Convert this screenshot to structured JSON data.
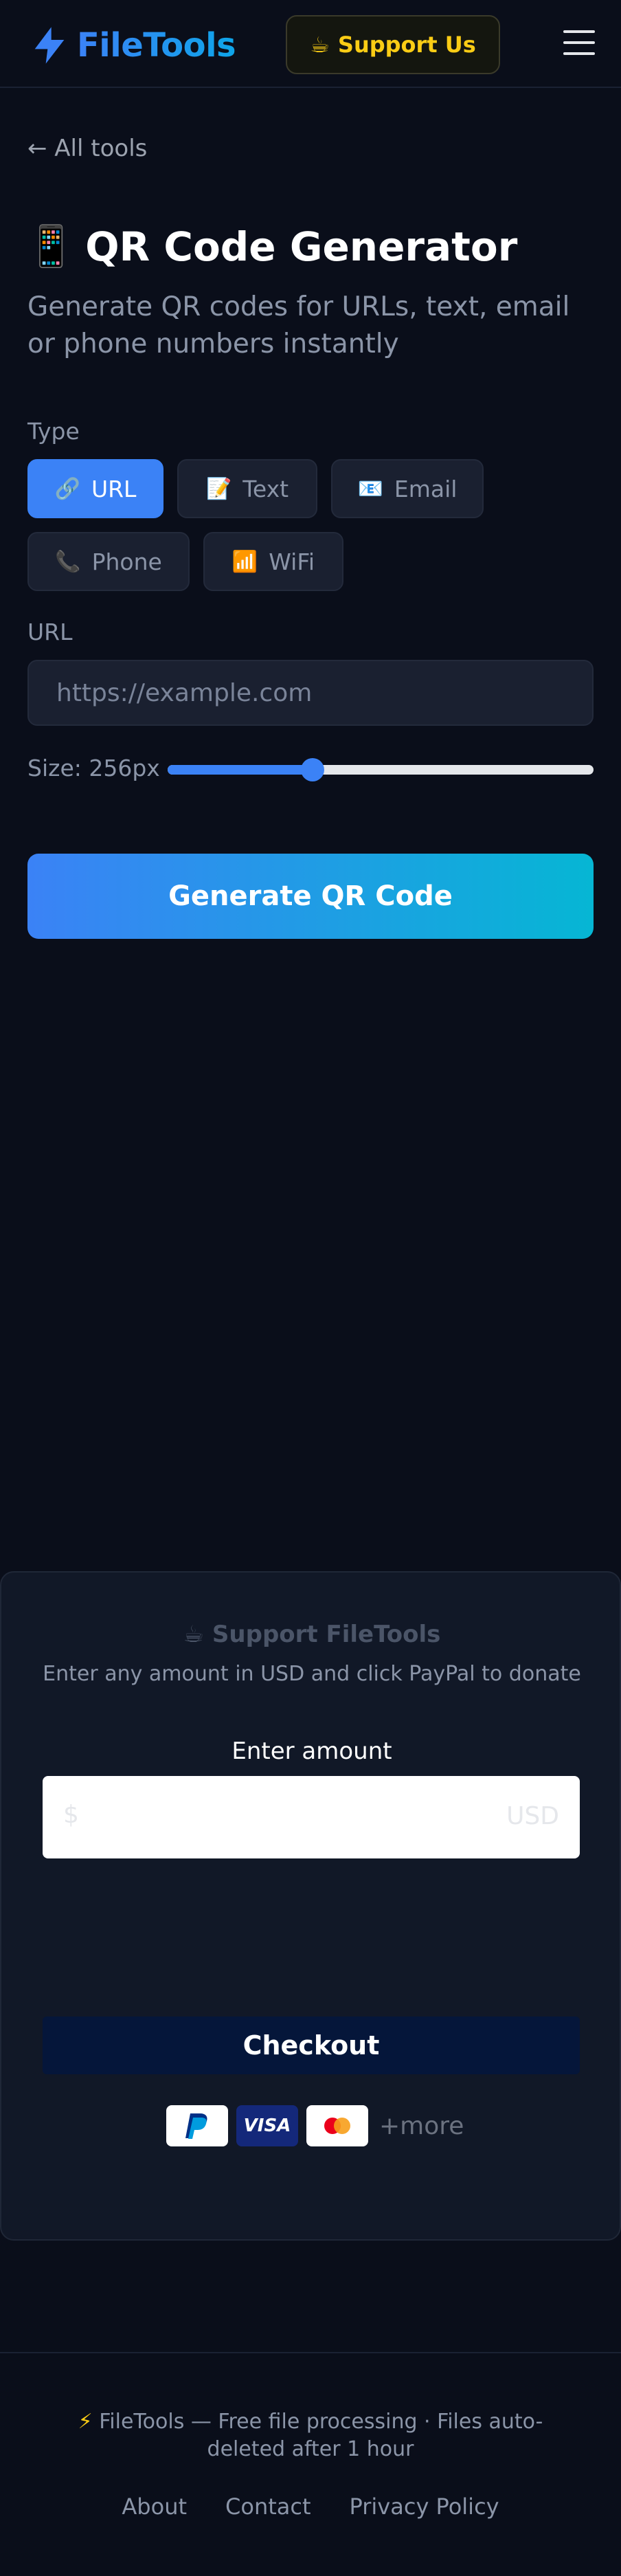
{
  "header": {
    "brand_name": "FileTools",
    "support_label": "Support Us",
    "support_icon": "coffee-icon",
    "menu_icon": "hamburger-menu-icon"
  },
  "nav": {
    "back_label": "← All tools"
  },
  "tool": {
    "icon": "📱",
    "title": "QR Code Generator",
    "subtitle": "Generate QR codes for URLs, text, email or phone numbers instantly"
  },
  "form": {
    "type_label": "Type",
    "types": [
      {
        "icon": "🔗",
        "label": "URL",
        "active": true
      },
      {
        "icon": "📝",
        "label": "Text",
        "active": false
      },
      {
        "icon": "📧",
        "label": "Email",
        "active": false
      },
      {
        "icon": "📞",
        "label": "Phone",
        "active": false
      },
      {
        "icon": "📶",
        "label": "WiFi",
        "active": false
      }
    ],
    "url_label": "URL",
    "url_value": "",
    "url_placeholder": "https://example.com",
    "size_label": "Size: 256px",
    "size_fraction": 0.34,
    "generate_label": "Generate QR Code"
  },
  "donate": {
    "title_icon": "☕",
    "title": "Support FileTools",
    "subtitle": "Enter any amount in USD and click PayPal to donate",
    "amount_label": "Enter amount",
    "currency_symbol": "$",
    "currency_code": "USD",
    "checkout_label": "Checkout",
    "more_label": "+more",
    "visa_label": "VISA"
  },
  "footer": {
    "bolt": "⚡",
    "text": "FileTools — Free file processing · Files auto-deleted after 1 hour",
    "links": [
      "About",
      "Contact",
      "Privacy Policy"
    ]
  },
  "colors": {
    "background": "#0a0e1a",
    "accent": "#3b82f6",
    "accent_cyan": "#06b6d4",
    "support_yellow": "#facc15"
  }
}
